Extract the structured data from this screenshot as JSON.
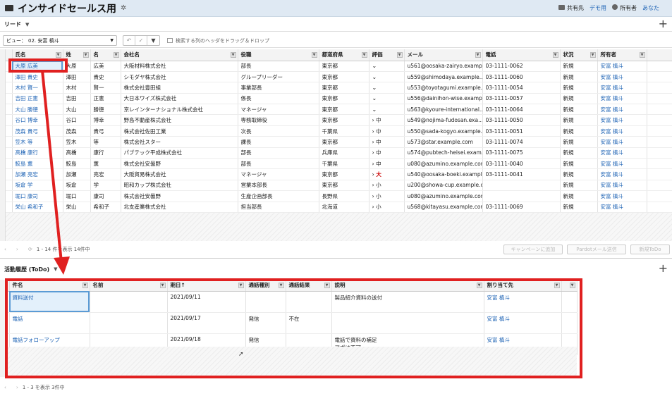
{
  "app": {
    "title": "インサイドセールス用",
    "shared_label": "共有先",
    "shared_value": "デモ用",
    "owner_label": "所有者",
    "owner_value": "あなた"
  },
  "leads": {
    "tab_label": "リード",
    "view_label": "ビュー：",
    "view_value": "02. 安富 槙斗",
    "groupby_hint": "検索する列のヘッダをドラッグ＆ドロップ",
    "columns": [
      "氏名",
      "姓",
      "名",
      "会社名",
      "役職",
      "都道府県",
      "評価",
      "メール",
      "電話",
      "状況",
      "所有者"
    ],
    "rows": [
      [
        "大原 広美",
        "大原",
        "広美",
        "大阪材料株式会社",
        "部長",
        "東京都",
        "",
        "u561@oosaka-zairyo.examp...",
        "03-1111-0062",
        "新規",
        "安富 槙斗"
      ],
      [
        "澤田 貴史",
        "澤田",
        "貴史",
        "シモダヤ株式会社",
        "グループリーダー",
        "東京都",
        "",
        "u559@shimodaya.example....",
        "03-1111-0060",
        "新規",
        "安富 槙斗"
      ],
      [
        "木村 賢一",
        "木村",
        "賢一",
        "株式会社豊田組",
        "事業部長",
        "東京都",
        "",
        "u553@toyotagumi.example.c...",
        "03-1111-0054",
        "新規",
        "安富 槙斗"
      ],
      [
        "吉田 正憲",
        "吉田",
        "正憲",
        "大日本ワイズ株式会社",
        "係長",
        "東京都",
        "",
        "u556@dainihon-wise.examp...",
        "03-1111-0057",
        "新規",
        "安富 槙斗"
      ],
      [
        "大山 勝徳",
        "大山",
        "勝徳",
        "京レインターナショナル株式会社",
        "マネージャ",
        "東京都",
        "",
        "u563@kyoure-international....",
        "03-1111-0064",
        "新規",
        "安富 槙斗"
      ],
      [
        "谷口 博幸",
        "谷口",
        "博幸",
        "野島不動産株式会社",
        "専務取締役",
        "東京都",
        "中",
        "u549@nojima-fudosan.exa...",
        "03-1111-0050",
        "新規",
        "安富 槙斗"
      ],
      [
        "茂森 貴弓",
        "茂森",
        "貴弓",
        "株式会社佐田工業",
        "次長",
        "千葉県",
        "中",
        "u550@sada-kogyo.example....",
        "03-1111-0051",
        "新規",
        "安富 槙斗"
      ],
      [
        "笠木 等",
        "笠木",
        "等",
        "株式会社スター",
        "課長",
        "東京都",
        "中",
        "u573@star.example.com",
        "03-1111-0074",
        "新規",
        "安富 槙斗"
      ],
      [
        "高橋 康行",
        "高橋",
        "康行",
        "パブテック平成株式会社",
        "部長",
        "兵庫県",
        "中",
        "u574@pubtech-heisei.exam...",
        "03-1111-0075",
        "新規",
        "安富 槙斗"
      ],
      [
        "鮫島 薫",
        "鮫島",
        "薫",
        "株式会社安曇野",
        "部長",
        "千葉県",
        "中",
        "u080@azumino.example.com",
        "03-1111-0040",
        "新規",
        "安富 槙斗"
      ],
      [
        "加瀬 亮宏",
        "加瀬",
        "亮宏",
        "大阪貿易株式会社",
        "マネージャ",
        "東京都",
        "大",
        "u540@oosaka-boeki.example....",
        "03-1111-0041",
        "新規",
        "安富 槙斗"
      ],
      [
        "坂倉 学",
        "坂倉",
        "学",
        "昭和カップ株式会社",
        "営業本部長",
        "東京都",
        "小",
        "u200@showa-cup.example.c...",
        "",
        "新規",
        "安富 槙斗"
      ],
      [
        "堀口 康司",
        "堀口",
        "康司",
        "株式会社安曇野",
        "生産企画部長",
        "長野県",
        "小",
        "u080@azumino.example.com",
        "",
        "新規",
        "安富 槙斗"
      ],
      [
        "栄山 希和子",
        "栄山",
        "希和子",
        "北支産業株式会社",
        "担当部長",
        "北海道",
        "小",
        "u568@kitayasu.example.com",
        "03-1111-0069",
        "新規",
        "安富 槙斗"
      ]
    ],
    "pager_text": "1 - 14 件を表示 14件中",
    "btn_campaign": "キャンペーンに追加",
    "btn_pardot": "Pardotメール送信",
    "btn_todo": "新規ToDo"
  },
  "todo": {
    "tab_label": "活動履歴 (ToDo)",
    "columns": [
      "件名",
      "名前",
      "期日↑",
      "通話種別",
      "通話結果",
      "説明",
      "割り当て先"
    ],
    "rows": [
      {
        "subject": "資料送付",
        "name": "",
        "due": "2021/09/11",
        "calltype": "",
        "result": "",
        "desc1": "製品紹介資料の送付",
        "desc2": "",
        "assignee": "安富 槙斗"
      },
      {
        "subject": "電話",
        "name": "",
        "due": "2021/09/17",
        "calltype": "発信",
        "result": "不在",
        "desc1": "",
        "desc2": "",
        "assignee": "安富 槙斗"
      },
      {
        "subject": "電話フォローアップ",
        "name": "",
        "due": "2021/09/18",
        "calltype": "発信",
        "result": "",
        "desc1": "電話で資料の補足",
        "desc2": "アポは不可",
        "assignee": "安富 槙斗"
      }
    ],
    "pager_text": "1 - 3 を表示 3件中"
  },
  "colors": {
    "accent_red": "#e02020",
    "link": "#1e63b5",
    "titlebar": "#dfe9f3"
  }
}
